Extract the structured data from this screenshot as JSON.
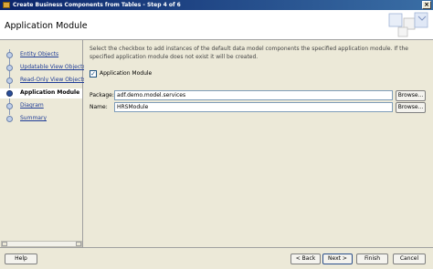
{
  "window": {
    "title": "Create Business Components from Tables - Step 4 of 6",
    "close_glyph": "×"
  },
  "header": {
    "title": "Application Module"
  },
  "nav": {
    "items": [
      {
        "label": "Entity Objects",
        "active": false
      },
      {
        "label": "Updatable View Objects",
        "active": false
      },
      {
        "label": "Read-Only View Objects",
        "active": false
      },
      {
        "label": "Application Module",
        "active": true
      },
      {
        "label": "Diagram",
        "active": false
      },
      {
        "label": "Summary",
        "active": false
      }
    ]
  },
  "content": {
    "instructions": "Select the checkbox to add instances of the default data model components the specified application module.  If the specified application module does not exist it will be created.",
    "checkbox_label": "Application Module",
    "checkbox_checked": true,
    "package_label": "Package:",
    "package_value": "adf.demo.model.services",
    "name_label": "Name:",
    "name_value": "HRSModule",
    "browse_label": "Browse..."
  },
  "footer": {
    "help": "Help",
    "back": "< Back",
    "next": "Next >",
    "finish": "Finish",
    "cancel": "Cancel"
  }
}
